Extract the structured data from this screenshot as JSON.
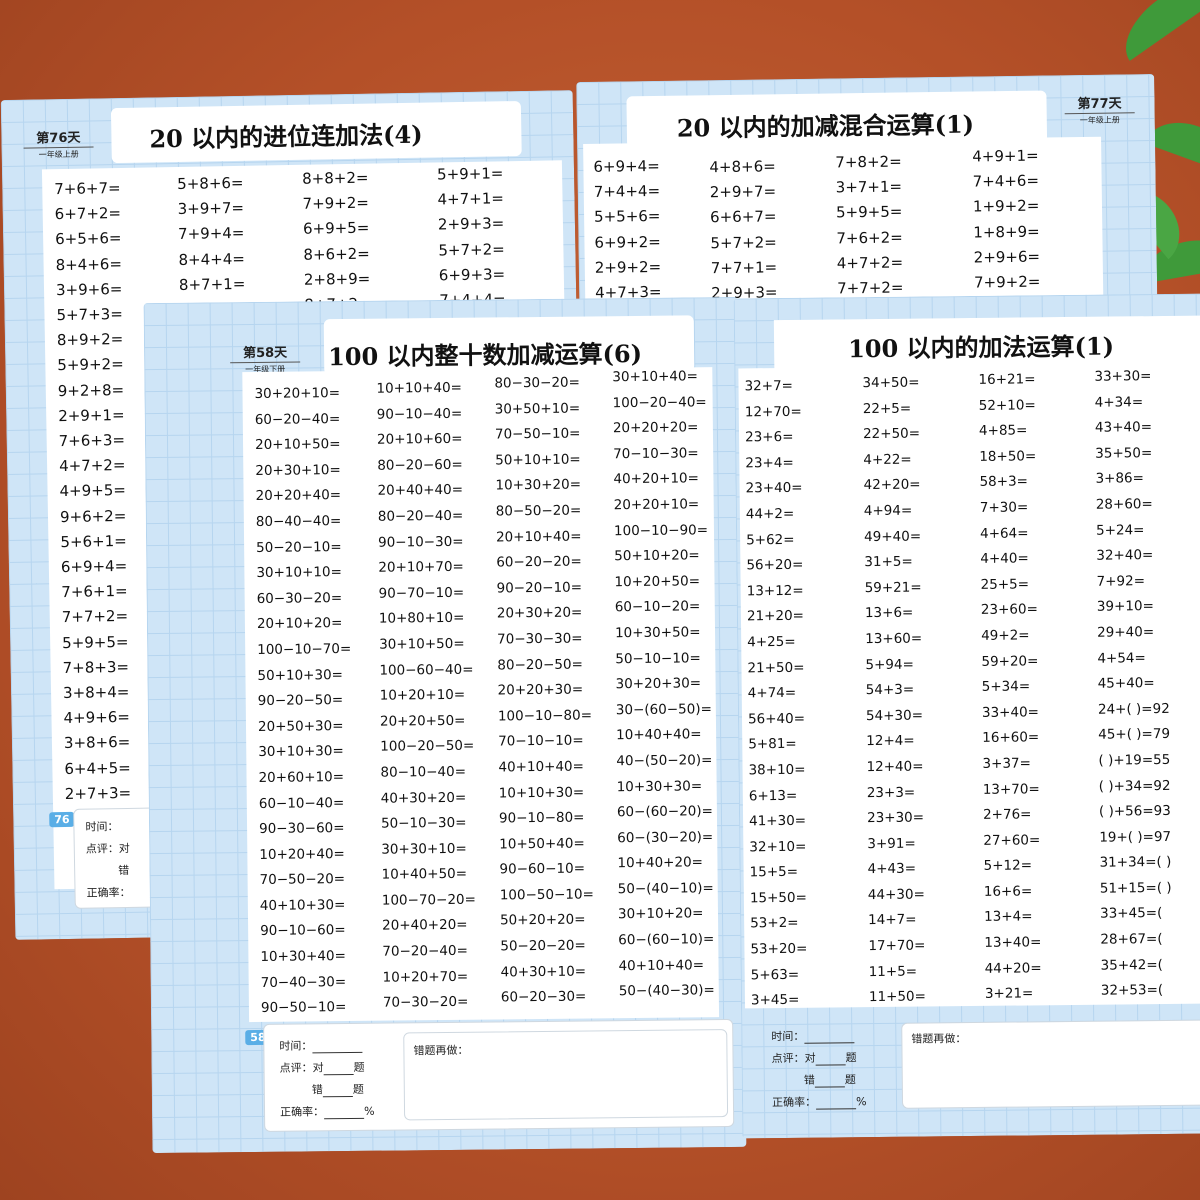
{
  "book_back": {
    "left_page": {
      "day": "第76天",
      "grade": "一年级上册",
      "title": "20 以内的进位连加法(4)",
      "page_number": "76",
      "columns": [
        [
          "7+6+7=",
          "6+7+2=",
          "6+5+6=",
          "8+4+6=",
          "3+9+6=",
          "5+7+3=",
          "8+9+2=",
          "5+9+2=",
          "9+2+8=",
          "2+9+1=",
          "7+6+3=",
          "4+7+2=",
          "4+9+5=",
          "9+6+2=",
          "5+6+1=",
          "6+9+4=",
          "7+6+1=",
          "7+7+2=",
          "5+9+5=",
          "7+8+3=",
          "3+8+4=",
          "4+9+6=",
          "3+8+6=",
          "6+4+5=",
          "2+7+3="
        ],
        [
          "5+8+6=",
          "3+9+7=",
          "7+9+4=",
          "8+4+4=",
          "8+7+1=",
          "3+9+3="
        ],
        [
          "8+8+2=",
          "7+9+2=",
          "6+9+5=",
          "8+6+2=",
          "2+8+9=",
          "8+7+2="
        ],
        [
          "5+9+1=",
          "4+7+1=",
          "2+9+3=",
          "5+7+2=",
          "6+9+3=",
          "7+4+4="
        ]
      ],
      "footer": {
        "time": "时间：",
        "review": "点评：对",
        "wrong": "错",
        "accuracy": "正确率："
      }
    },
    "right_page": {
      "day": "第77天",
      "grade": "一年级上册",
      "title": "20 以内的加减混合运算(1)",
      "columns": [
        [
          "6+9+4=",
          "7+4+4=",
          "5+5+6=",
          "6+9+2=",
          "2+9+2=",
          "4+7+3="
        ],
        [
          "4+8+6=",
          "2+9+7=",
          "6+6+7=",
          "5+7+2=",
          "7+7+1=",
          "2+9+3="
        ],
        [
          "7+8+2=",
          "3+7+1=",
          "5+9+5=",
          "7+6+2=",
          "4+7+2=",
          "7+7+2="
        ],
        [
          "4+9+1=",
          "7+4+6=",
          "1+9+2=",
          "1+8+9=",
          "2+9+6=",
          "7+9+2="
        ]
      ]
    }
  },
  "book_front": {
    "left_page": {
      "day": "第58天",
      "grade": "一年级下册",
      "title": "100 以内整十数加减运算(6)",
      "page_number": "58",
      "columns": [
        [
          "30+20+10=",
          "60−20−40=",
          "20+10+50=",
          "20+30+10=",
          "20+20+40=",
          "80−40−40=",
          "50−20−10=",
          "30+10+10=",
          "60−30−20=",
          "20+10+20=",
          "100−10−70=",
          "50+10+30=",
          "90−20−50=",
          "20+50+30=",
          "30+10+30=",
          "20+60+10=",
          "60−10−40=",
          "90−30−60=",
          "10+20+40=",
          "70−50−20=",
          "40+10+30=",
          "90−10−60=",
          "10+30+40=",
          "70−40−30=",
          "90−50−10="
        ],
        [
          "10+10+40=",
          "90−10−40=",
          "20+10+60=",
          "80−20−60=",
          "20+40+40=",
          "80−20−40=",
          "90−10−30=",
          "20+10+70=",
          "90−70−10=",
          "10+80+10=",
          "30+10+50=",
          "100−60−40=",
          "10+20+10=",
          "20+20+50=",
          "100−20−50=",
          "80−10−40=",
          "40+30+20=",
          "50−10−30=",
          "30+30+10=",
          "10+40+50=",
          "100−70−20=",
          "20+40+20=",
          "70−20−40=",
          "10+20+70=",
          "70−30−20="
        ],
        [
          "80−30−20=",
          "30+50+10=",
          "70−50−10=",
          "50+10+10=",
          "10+30+20=",
          "80−50−20=",
          "20+10+40=",
          "60−20−20=",
          "90−20−10=",
          "20+30+20=",
          "70−30−30=",
          "80−20−50=",
          "20+20+30=",
          "100−10−80=",
          "70−10−10=",
          "40+10+40=",
          "10+10+30=",
          "90−10−80=",
          "10+50+40=",
          "90−60−10=",
          "100−50−10=",
          "50+20+20=",
          "50−20−20=",
          "40+30+10=",
          "60−20−30="
        ],
        [
          "30+10+40=",
          "100−20−40=",
          "20+20+20=",
          "70−10−30=",
          "40+20+10=",
          "20+20+10=",
          "100−10−90=",
          "50+10+20=",
          "10+20+50=",
          "60−10−20=",
          "10+30+50=",
          "50−10−10=",
          "30+20+30=",
          "30−(60−50)=",
          "10+40+40=",
          "40−(50−20)=",
          "10+30+30=",
          "60−(60−20)=",
          "60−(30−20)=",
          "10+40+20=",
          "50−(40−10)=",
          "30+10+20=",
          "60−(60−10)=",
          "40+10+40=",
          "50−(40−30)="
        ]
      ],
      "footer": {
        "time": "时间：",
        "review": "点评：对",
        "wrong": "错",
        "ti": "题",
        "accuracy": "正确率：",
        "percent": "%",
        "redo": "错题再做："
      }
    },
    "right_page": {
      "title": "100 以内的加法运算(1)",
      "columns": [
        [
          "32+7=",
          "12+70=",
          "23+6=",
          "23+4=",
          "23+40=",
          "44+2=",
          "5+62=",
          "56+20=",
          "13+12=",
          "21+20=",
          "4+25=",
          "21+50=",
          "4+74=",
          "56+40=",
          "5+81=",
          "38+10=",
          "6+13=",
          "41+30=",
          "32+10=",
          "15+5=",
          "15+50=",
          "53+2=",
          "53+20=",
          "5+63=",
          "3+45="
        ],
        [
          "34+50=",
          "22+5=",
          "22+50=",
          "4+22=",
          "42+20=",
          "4+94=",
          "49+40=",
          "31+5=",
          "59+21=",
          "13+6=",
          "13+60=",
          "5+94=",
          "54+3=",
          "54+30=",
          "12+4=",
          "12+40=",
          "23+3=",
          "23+30=",
          "3+91=",
          "4+43=",
          "44+30=",
          "14+7=",
          "17+70=",
          "11+5=",
          "11+50="
        ],
        [
          "16+21=",
          "52+10=",
          "4+85=",
          "18+50=",
          "58+3=",
          "7+30=",
          "4+64=",
          "4+40=",
          "25+5=",
          "23+60=",
          "49+2=",
          "59+20=",
          "5+34=",
          "33+40=",
          "16+60=",
          "3+37=",
          "13+70=",
          "2+76=",
          "27+60=",
          "5+12=",
          "16+6=",
          "13+4=",
          "13+40=",
          "44+20=",
          "3+21="
        ],
        [
          "33+30=",
          "4+34=",
          "43+40=",
          "35+50=",
          "3+86=",
          "28+60=",
          "5+24=",
          "32+40=",
          "7+92=",
          "39+10=",
          "29+40=",
          "4+54=",
          "45+40=",
          "24+(    )=92",
          "45+(    )=79",
          "(    )+19=55",
          "(    )+34=92",
          "(    )+56=93",
          "19+(    )=97",
          "31+34=(    )",
          "51+15=(    )",
          "33+45=(",
          "28+67=(",
          "35+42=(",
          "32+53=("
        ]
      ],
      "footer": {
        "time": "时间：",
        "review": "点评：对",
        "wrong": "错",
        "ti": "题",
        "accuracy": "正确率：",
        "percent": "%",
        "redo": "错题再做："
      }
    }
  }
}
